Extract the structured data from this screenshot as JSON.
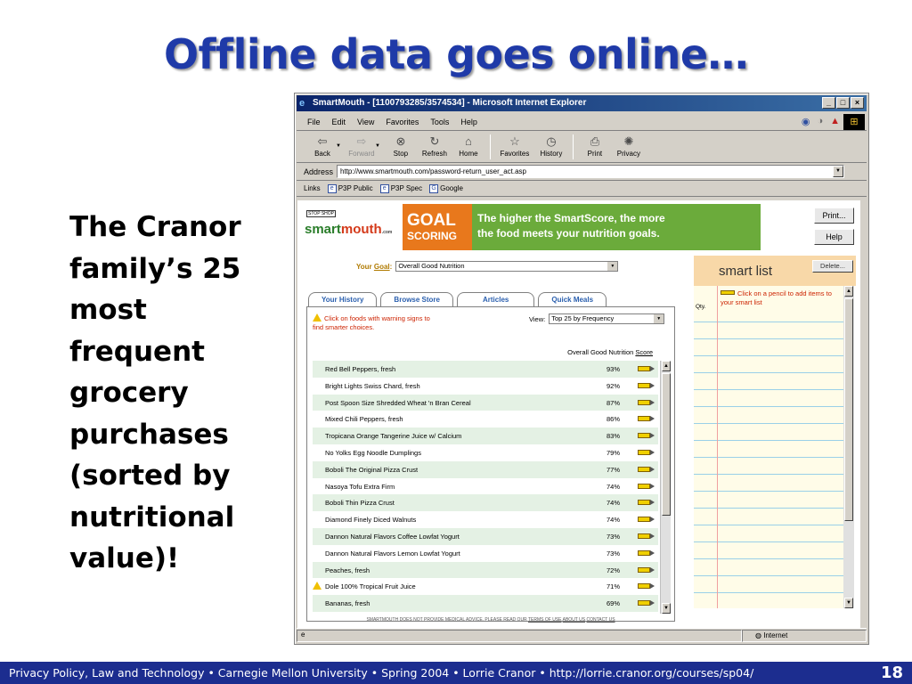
{
  "slide": {
    "title": "Offline data goes online…",
    "side_text": "The Cranor family’s 25 most frequent grocery purchases (sorted by nutritional value)!",
    "footer": "Privacy Policy, Law and Technology • Carnegie Mellon University • Spring 2004 • Lorrie Cranor • http://lorrie.cranor.org/courses/sp04/",
    "page_number": "18"
  },
  "browser": {
    "title": "SmartMouth - [1100793285/3574534] - Microsoft Internet Explorer",
    "menu": [
      "File",
      "Edit",
      "View",
      "Favorites",
      "Tools",
      "Help"
    ],
    "toolbar": [
      {
        "label": "Back",
        "icon": "back-arrow-icon",
        "glyph": "⇦"
      },
      {
        "label": "Forward",
        "icon": "forward-arrow-icon",
        "glyph": "⇨",
        "disabled": true
      },
      {
        "label": "Stop",
        "icon": "stop-icon",
        "glyph": "⊗"
      },
      {
        "label": "Refresh",
        "icon": "refresh-icon",
        "glyph": "↻"
      },
      {
        "label": "Home",
        "icon": "home-icon",
        "glyph": "⌂"
      },
      {
        "label": "Favorites",
        "icon": "favorites-icon",
        "glyph": "☆"
      },
      {
        "label": "History",
        "icon": "history-icon",
        "glyph": "◷"
      },
      {
        "label": "Print",
        "icon": "print-icon",
        "glyph": "⎙"
      },
      {
        "label": "Privacy",
        "icon": "privacy-icon",
        "glyph": "✺"
      }
    ],
    "address_label": "Address",
    "address": "http://www.smartmouth.com/password-return_user_act.asp",
    "links_label": "Links",
    "links": [
      "P3P Public",
      "P3P Spec",
      "Google"
    ],
    "status": "Internet"
  },
  "page": {
    "logo_top": "STOP SHOP",
    "logo_smart": "smart",
    "logo_mouth": "mouth",
    "logo_com": ".com",
    "banner_goal": "GOAL",
    "banner_scoring": "SCORING",
    "banner_line1": "The higher the SmartScore, the more",
    "banner_line2": "the food meets your nutrition goals.",
    "print_button": "Print...",
    "help_button": "Help",
    "goal_label_pre": "Your",
    "goal_label_word": "Goal",
    "goal_label_post": ":",
    "goal_value": "Overall Good Nutrition",
    "tabs": [
      "Your History",
      "Browse Store",
      "Articles",
      "Quick Meals"
    ],
    "warning_note_1": "Click on foods with warning signs to",
    "warning_note_2": "find smarter choices.",
    "view_label": "View:",
    "view_value": "Top 25 by Frequency",
    "score_header_pre": "Overall Good Nutrition",
    "score_header_link": "Score",
    "foods": [
      {
        "name": "Red Bell Peppers, fresh",
        "score": "93%",
        "warn": false
      },
      {
        "name": "Bright Lights Swiss Chard, fresh",
        "score": "92%",
        "warn": false
      },
      {
        "name": "Post Spoon Size Shredded Wheat 'n Bran Cereal",
        "score": "87%",
        "warn": false
      },
      {
        "name": "Mixed Chili Peppers, fresh",
        "score": "86%",
        "warn": false
      },
      {
        "name": "Tropicana Orange Tangerine Juice w/ Calcium",
        "score": "83%",
        "warn": false
      },
      {
        "name": "No Yolks Egg Noodle Dumplings",
        "score": "79%",
        "warn": false
      },
      {
        "name": "Boboli The Original Pizza Crust",
        "score": "77%",
        "warn": false
      },
      {
        "name": "Nasoya Tofu Extra Firm",
        "score": "74%",
        "warn": false
      },
      {
        "name": "Boboli Thin Pizza Crust",
        "score": "74%",
        "warn": false
      },
      {
        "name": "Diamond Finely Diced Walnuts",
        "score": "74%",
        "warn": false
      },
      {
        "name": "Dannon Natural Flavors Coffee Lowfat Yogurt",
        "score": "73%",
        "warn": false
      },
      {
        "name": "Dannon Natural Flavors Lemon Lowfat Yogurt",
        "score": "73%",
        "warn": false
      },
      {
        "name": "Peaches, fresh",
        "score": "72%",
        "warn": false
      },
      {
        "name": "Dole 100% Tropical Fruit Juice",
        "score": "71%",
        "warn": true
      },
      {
        "name": "Bananas, fresh",
        "score": "69%",
        "warn": false
      }
    ],
    "disclaimer_pre": "SMARTMOUTH DOES NOT PROVIDE MEDICAL ADVICE. PLEASE READ OUR",
    "disclaimer_links": [
      "TERMS OF USE",
      "ABOUT US",
      "CONTACT US"
    ],
    "smart_list_title": "smart list",
    "delete_button": "Delete...",
    "qty_label": "Qty.",
    "pencil_note": "Click on a pencil to add items to your smart list"
  },
  "colors": {
    "title_blue": "#1f3aa8",
    "footer_blue": "#1c2d8f",
    "goal_orange": "#e8781c",
    "banner_green": "#6bab3b"
  }
}
